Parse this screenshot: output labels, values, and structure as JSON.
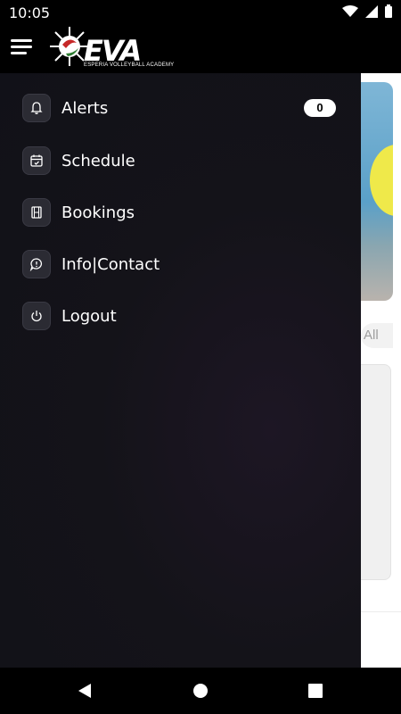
{
  "status_bar": {
    "time": "10:05"
  },
  "header": {
    "logo_text": "EVA",
    "logo_subtitle": "ESPERIA VOLLEYBALL ACADEMY"
  },
  "drawer": {
    "items": [
      {
        "label": "Alerts",
        "icon": "bell-icon",
        "badge": "0"
      },
      {
        "label": "Schedule",
        "icon": "calendar-icon"
      },
      {
        "label": "Bookings",
        "icon": "film-icon"
      },
      {
        "label": "Info|Contact",
        "icon": "chat-icon"
      },
      {
        "label": "Logout",
        "icon": "power-icon"
      }
    ]
  },
  "background": {
    "filter_label": "All"
  },
  "colors": {
    "drawer_bg": "#141319",
    "icon_bg": "#2b2b33",
    "badge_bg": "#ffffff"
  }
}
